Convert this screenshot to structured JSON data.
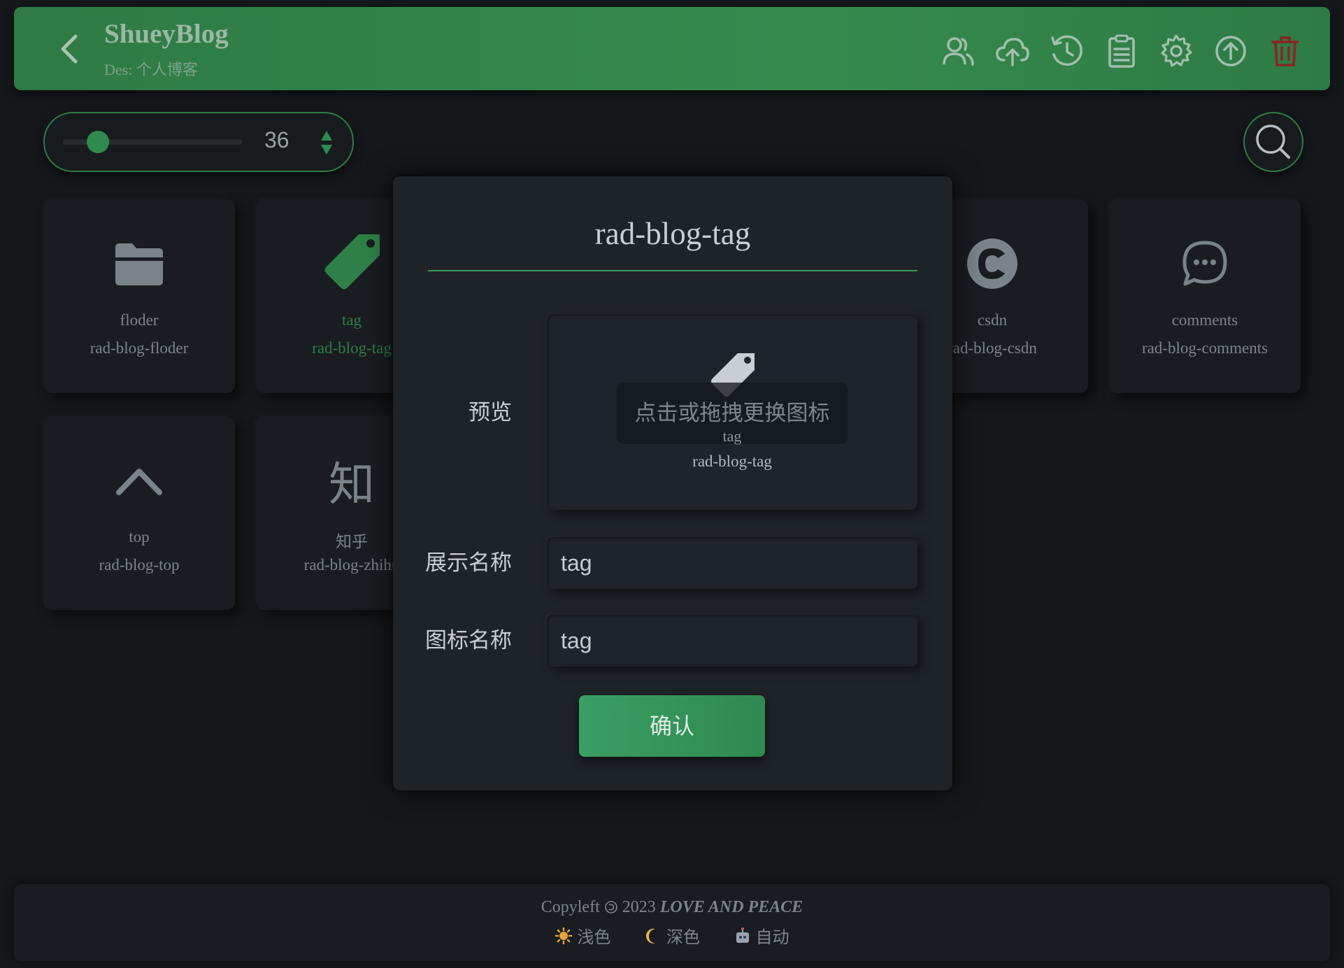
{
  "header": {
    "title": "ShueyBlog",
    "subtitle": "Des: 个人博客",
    "icons": [
      "back-icon",
      "users-icon",
      "cloud-upload-icon",
      "history-icon",
      "clipboard-icon",
      "gear-icon",
      "upload-circle-icon",
      "trash-icon"
    ],
    "colors": {
      "bar": "#2f7a45",
      "delete": "#8a2424"
    }
  },
  "toolbar": {
    "size_value": "36",
    "size_level": 0.15
  },
  "cards": [
    {
      "name": "floder",
      "icon": "rad-blog-floder",
      "glyph": "folder-icon"
    },
    {
      "name": "tag",
      "icon": "rad-blog-tag",
      "glyph": "tag-icon"
    },
    {
      "name": "csdn",
      "icon": "rad-blog-csdn",
      "glyph": "csdn-icon"
    },
    {
      "name": "comments",
      "icon": "rad-blog-comments",
      "glyph": "comments-icon"
    },
    {
      "name": "top",
      "icon": "rad-blog-top",
      "glyph": "chevron-up-icon"
    },
    {
      "name": "知乎",
      "icon": "rad-blog-zhihu",
      "glyph": "知"
    }
  ],
  "modal": {
    "title": "rad-blog-tag",
    "preview_label": "预览",
    "preview_overlay": "点击或拖拽更换图标",
    "preview_name": "tag",
    "preview_icon": "rad-blog-tag",
    "display_label": "展示名称",
    "display_value": "tag",
    "icon_label": "图标名称",
    "icon_value": "tag",
    "confirm": "确认"
  },
  "footer": {
    "copyleft": "Copyleft ",
    "year": " 2023 ",
    "motto": "LOVE AND PEACE",
    "light": "浅色",
    "dark": "深色",
    "auto": "自动"
  }
}
